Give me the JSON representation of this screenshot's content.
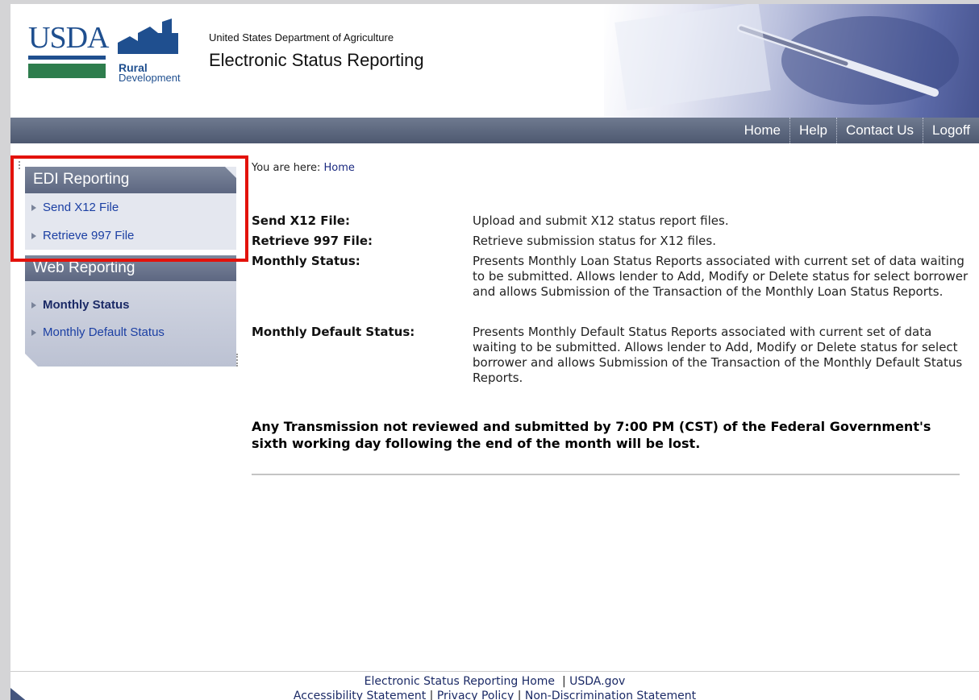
{
  "header": {
    "logo_text": "USDA",
    "logo_sub1": "Rural",
    "logo_sub2": "Development",
    "agency": "United States Department of Agriculture",
    "app_title": "Electronic Status Reporting"
  },
  "nav": {
    "items": [
      "Home",
      "Help",
      "Contact Us",
      "Logoff"
    ]
  },
  "sidebar": {
    "edi_title": "EDI Reporting",
    "edi_items": [
      "Send X12 File",
      "Retrieve 997 File"
    ],
    "web_title": "Web Reporting",
    "web_items": [
      "Monthly Status",
      "Monthly Default Status"
    ]
  },
  "main": {
    "breadcrumb_prefix": "You are here:",
    "breadcrumb_link": "Home",
    "rows": [
      {
        "label": "Send X12 File:",
        "desc": "Upload and submit X12 status report files."
      },
      {
        "label": "Retrieve 997 File:",
        "desc": "Retrieve submission status for X12 files."
      },
      {
        "label": "Monthly Status:",
        "desc": "Presents Monthly Loan Status Reports associated with current set of data waiting to be submitted. Allows lender to Add, Modify or Delete status for select borrower and allows Submission of the Transaction of the Monthly Loan Status Reports."
      },
      {
        "label": "Monthly Default Status:",
        "desc": "Presents Monthly Default Status Reports associated with current set of data waiting to be submitted. Allows lender to Add, Modify or Delete status for select borrower and allows Submission of the Transaction of the Monthly Default Status Reports."
      }
    ],
    "notice": "Any Transmission not reviewed and submitted by 7:00 PM (CST) of the Federal Government's sixth working day following the end of the month will be lost."
  },
  "footer": {
    "home_link": "Electronic Status Reporting Home",
    "sep": "|",
    "usda_link": "USDA.gov",
    "accessibility": "Accessibility Statement",
    "privacy": "Privacy Policy",
    "nondiscrimination": "Non-Discrimination Statement"
  },
  "colors": {
    "nav_bg": "#5a6579",
    "highlight_frame": "#e3120b",
    "link": "#1b3fa3"
  }
}
